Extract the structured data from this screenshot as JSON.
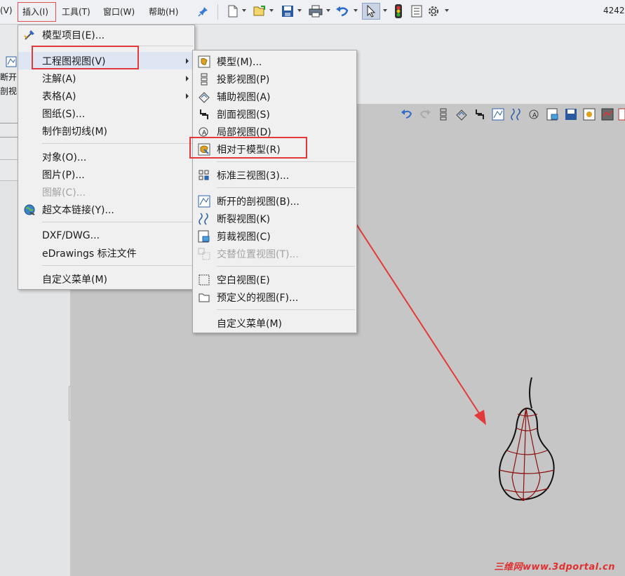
{
  "menubar": {
    "items": [
      "(V)",
      "插入(I)",
      "工具(T)",
      "窗口(W)",
      "帮助(H)"
    ],
    "right_text": "4242"
  },
  "left_panel": {
    "label1": "断开",
    "label2": "剖视"
  },
  "insert_menu": {
    "items": [
      {
        "label": "模型项目(E)...",
        "icon": "model-items-icon"
      },
      {
        "label": "工程图视图(V)",
        "submenu": true
      },
      {
        "label": "注解(A)",
        "submenu": true
      },
      {
        "label": "表格(A)",
        "submenu": true
      },
      {
        "label": "图纸(S)..."
      },
      {
        "label": "制作剖切线(M)"
      },
      {
        "label": "对象(O)..."
      },
      {
        "label": "图片(P)..."
      },
      {
        "label": "图解(C)...",
        "disabled": true
      },
      {
        "label": "超文本链接(Y)...",
        "icon": "hyperlink-globe-icon"
      },
      {
        "label": "DXF/DWG..."
      },
      {
        "label": "eDrawings 标注文件"
      },
      {
        "label": "自定义菜单(M)"
      }
    ]
  },
  "drawing_view_submenu": {
    "items": [
      {
        "label": "模型(M)...",
        "icon": "model-view-icon"
      },
      {
        "label": "投影视图(P)",
        "icon": "projected-view-icon"
      },
      {
        "label": "辅助视图(A)",
        "icon": "auxiliary-view-icon"
      },
      {
        "label": "剖面视图(S)",
        "icon": "section-view-icon"
      },
      {
        "label": "局部视图(D)",
        "icon": "detail-view-icon"
      },
      {
        "label": "相对于模型(R)",
        "icon": "relative-to-model-icon"
      },
      {
        "label": "标准三视图(3)...",
        "icon": "standard-3-view-icon"
      },
      {
        "label": "断开的剖视图(B)...",
        "icon": "broken-out-section-icon"
      },
      {
        "label": "断裂视图(K)",
        "icon": "break-view-icon"
      },
      {
        "label": "剪裁视图(C)",
        "icon": "crop-view-icon"
      },
      {
        "label": "交替位置视图(T)...",
        "icon": "alternate-position-view-icon",
        "disabled": true
      },
      {
        "label": "空白视图(E)",
        "icon": "empty-view-icon"
      },
      {
        "label": "预定义的视图(F)...",
        "icon": "predefined-view-icon"
      },
      {
        "label": "自定义菜单(M)"
      }
    ]
  },
  "watermark": "三维网www.3dportal.cn",
  "colors": {
    "highlight_box": "#e23a3a",
    "arrow": "#e23a3a",
    "canvas": "#c6c6c6",
    "menu_bg": "#f0f0f0",
    "model_outline": "#8b1010"
  }
}
